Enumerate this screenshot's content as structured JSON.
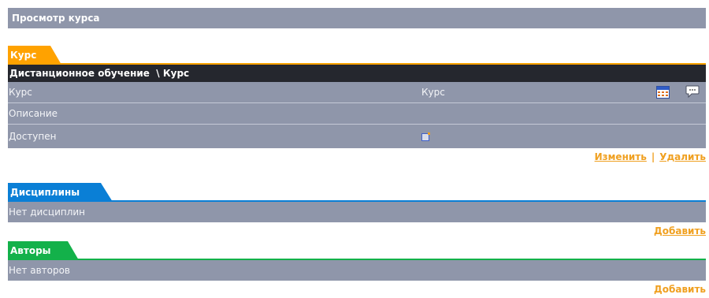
{
  "page_title": "Просмотр курса",
  "course": {
    "tab_label": "Курс",
    "breadcrumb": "Дистанционное обучение  \\ Курс",
    "rows": [
      {
        "label": "Курс",
        "value": "Курс"
      },
      {
        "label": "Описание",
        "value": ""
      },
      {
        "label": "Доступен",
        "value": ""
      }
    ],
    "icons": [
      "calendar-icon",
      "comment-icon"
    ],
    "edit_link": "Изменить",
    "separator": "|",
    "delete_link": "Удалить"
  },
  "disciplines": {
    "tab_label": "Дисциплины",
    "empty_text": "Нет дисциплин",
    "add_link": "Добавить"
  },
  "authors": {
    "tab_label": "Авторы",
    "empty_text": "Нет авторов",
    "add_link": "Добавить"
  },
  "colors": {
    "course_tab": "#ffa200",
    "disciplines_tab": "#0a7fd6",
    "authors_tab": "#13b14a",
    "row_bg": "#8f96aa",
    "breadcrumb_bg": "#25272e",
    "link": "#f0a020"
  }
}
